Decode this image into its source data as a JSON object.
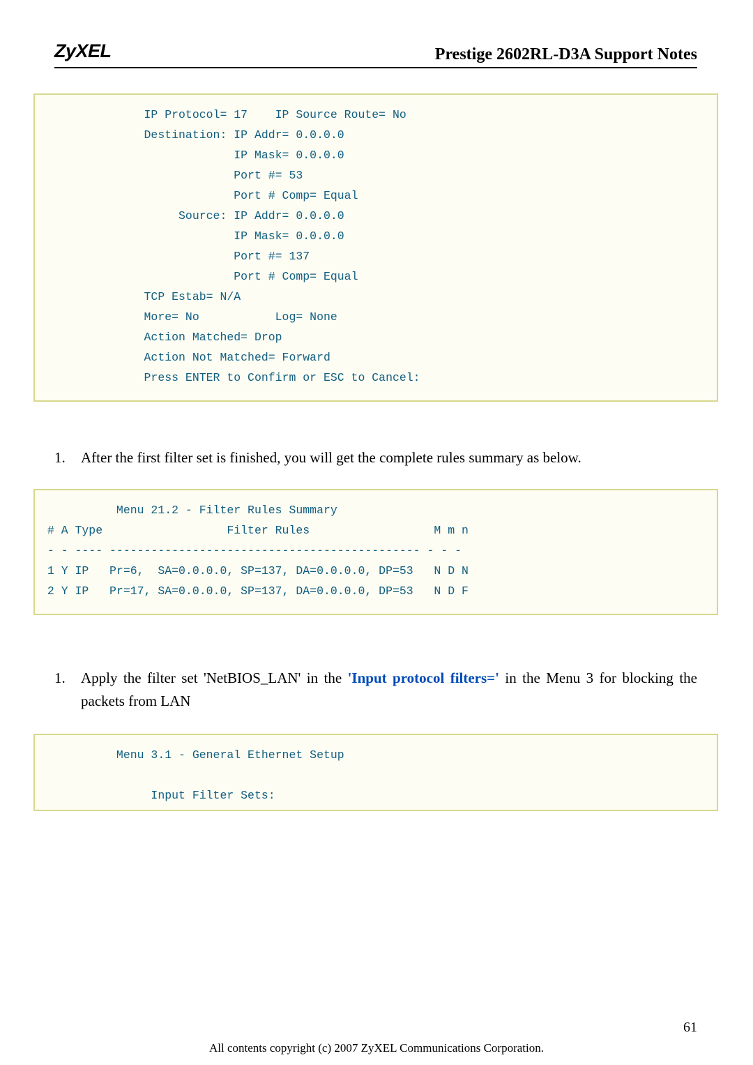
{
  "header": {
    "logo": "ZyXEL",
    "title": "Prestige 2602RL-D3A Support Notes"
  },
  "codeblock1": "               IP Protocol= 17    IP Source Route= No\n               Destination: IP Addr= 0.0.0.0\n                            IP Mask= 0.0.0.0\n                            Port #= 53\n                            Port # Comp= Equal\n                    Source: IP Addr= 0.0.0.0\n                            IP Mask= 0.0.0.0\n                            Port #= 137\n                            Port # Comp= Equal\n               TCP Estab= N/A\n               More= No           Log= None\n               Action Matched= Drop\n               Action Not Matched= Forward\n               Press ENTER to Confirm or ESC to Cancel:",
  "para1": {
    "num": "1.",
    "text": "After the first filter set is finished, you will get the complete rules summary as below."
  },
  "codeblock2": "           Menu 21.2 - Filter Rules Summary\n # A Type                  Filter Rules                  M m n\n - - ---- --------------------------------------------- - - -\n 1 Y IP   Pr=6,  SA=0.0.0.0, SP=137, DA=0.0.0.0, DP=53   N D N\n 2 Y IP   Pr=17, SA=0.0.0.0, SP=137, DA=0.0.0.0, DP=53   N D F",
  "para2": {
    "num": "1.",
    "text_pre": "Apply the filter set 'NetBIOS_LAN' in the ",
    "highlight": "'Input protocol filters='",
    "text_post": " in the Menu 3 for blocking the packets from LAN"
  },
  "codeblock3": "           Menu 3.1 - General Ethernet Setup\n\n                Input Filter Sets:",
  "footer": {
    "page": "61",
    "copyright": "All contents copyright (c) 2007 ZyXEL Communications Corporation."
  }
}
